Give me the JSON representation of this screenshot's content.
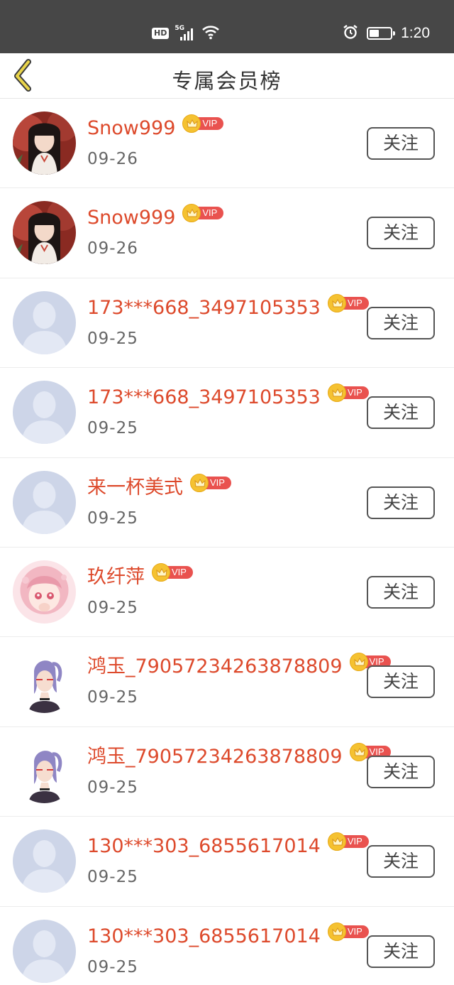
{
  "status_bar": {
    "hd_label": "HD",
    "network_label": "5G",
    "time": "1:20"
  },
  "header": {
    "title": "专属会员榜",
    "back_icon": "chevron-left-icon"
  },
  "accent_colors": {
    "name": "#dd4a2c",
    "vip_pill": "#e9524f",
    "crown": "#f5c231",
    "back_chevron": "#e9d44a"
  },
  "members": [
    {
      "name": "Snow999",
      "vip_label": "VIP",
      "date": "09-26",
      "follow_label": "关注",
      "avatar": "anime-girl-red-avatar"
    },
    {
      "name": "Snow999",
      "vip_label": "VIP",
      "date": "09-26",
      "follow_label": "关注",
      "avatar": "anime-girl-red-avatar"
    },
    {
      "name": "173***668_3497105353",
      "vip_label": "VIP",
      "date": "09-25",
      "follow_label": "关注",
      "avatar": "default-person-avatar"
    },
    {
      "name": "173***668_3497105353",
      "vip_label": "VIP",
      "date": "09-25",
      "follow_label": "关注",
      "avatar": "default-person-avatar"
    },
    {
      "name": "来一杯美式",
      "vip_label": "VIP",
      "date": "09-25",
      "follow_label": "关注",
      "avatar": "default-person-avatar"
    },
    {
      "name": "玖纤萍",
      "vip_label": "VIP",
      "date": "09-25",
      "follow_label": "关注",
      "avatar": "pink-hair-girl-avatar"
    },
    {
      "name": "鸿玉_79057234263878809",
      "vip_label": "VIP",
      "date": "09-25",
      "follow_label": "关注",
      "avatar": "purple-hair-girl-avatar"
    },
    {
      "name": "鸿玉_79057234263878809",
      "vip_label": "VIP",
      "date": "09-25",
      "follow_label": "关注",
      "avatar": "purple-hair-girl-avatar"
    },
    {
      "name": "130***303_6855617014",
      "vip_label": "VIP",
      "date": "09-25",
      "follow_label": "关注",
      "avatar": "default-person-avatar"
    },
    {
      "name": "130***303_6855617014",
      "vip_label": "VIP",
      "date": "09-25",
      "follow_label": "关注",
      "avatar": "default-person-avatar"
    }
  ]
}
